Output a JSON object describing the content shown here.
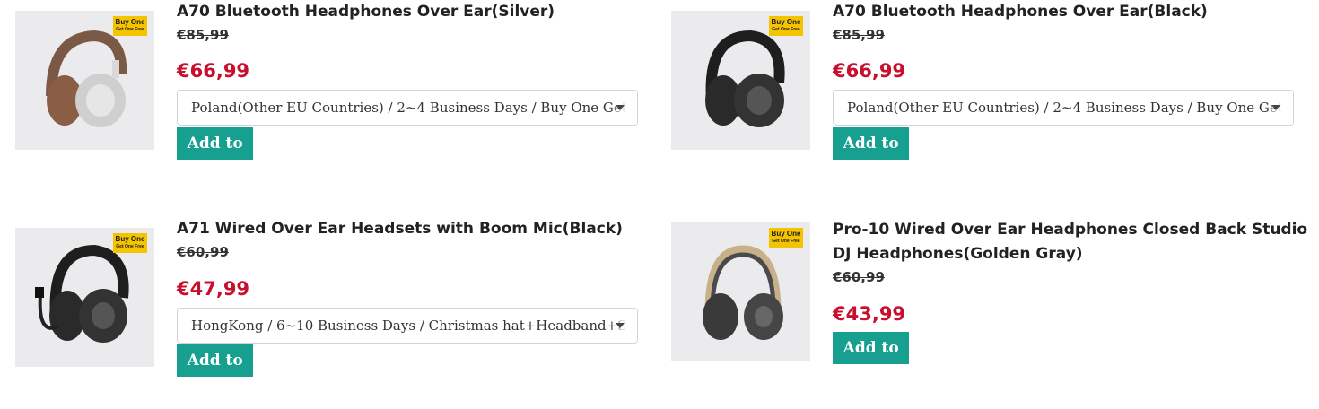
{
  "products": [
    {
      "title": "A70 Bluetooth Headphones Over Ear(Silver)",
      "old_price": "€85,99",
      "price": "€66,99",
      "option": "Poland(Other EU Countries) / 2~4 Business Days / Buy One Get One Free",
      "button": "Add to Basket",
      "badge": {
        "line1": "Buy One",
        "line2": "Get One Free"
      },
      "image_icon": "headphones-silver-icon"
    },
    {
      "title": "A70 Bluetooth Headphones Over Ear(Black)",
      "old_price": "€85,99",
      "price": "€66,99",
      "option": "Poland(Other EU Countries) / 2~4 Business Days / Buy One Get One Free",
      "button": "Add to Basket",
      "badge": {
        "line1": "Buy One",
        "line2": "Get One Free"
      },
      "image_icon": "headphones-black-icon"
    },
    {
      "title": "A71 Wired Over Ear Headsets with Boom Mic(Black)",
      "old_price": "€60,99",
      "price": "€47,99",
      "option": "HongKong / 6~10 Business Days / Christmas hat+Headband+Stand+",
      "button": "Add to Basket",
      "badge": {
        "line1": "Buy One",
        "line2": "Get One Free"
      },
      "image_icon": "headset-mic-icon"
    },
    {
      "title_line1": "Pro-10 Wired Over Ear Headphones Closed Back Studio",
      "title_line2": "DJ Headphones(Golden Gray)",
      "old_price": "€60,99",
      "price": "€43,99",
      "button": "Add to Basket",
      "badge": {
        "line1": "Buy One",
        "line2": "Get One Free"
      },
      "image_icon": "headphones-gray-icon"
    }
  ],
  "colors": {
    "price": "#c8102e",
    "button": "#17a08f",
    "badge": "#f5c400",
    "thumb_bg": "#ebebee"
  }
}
